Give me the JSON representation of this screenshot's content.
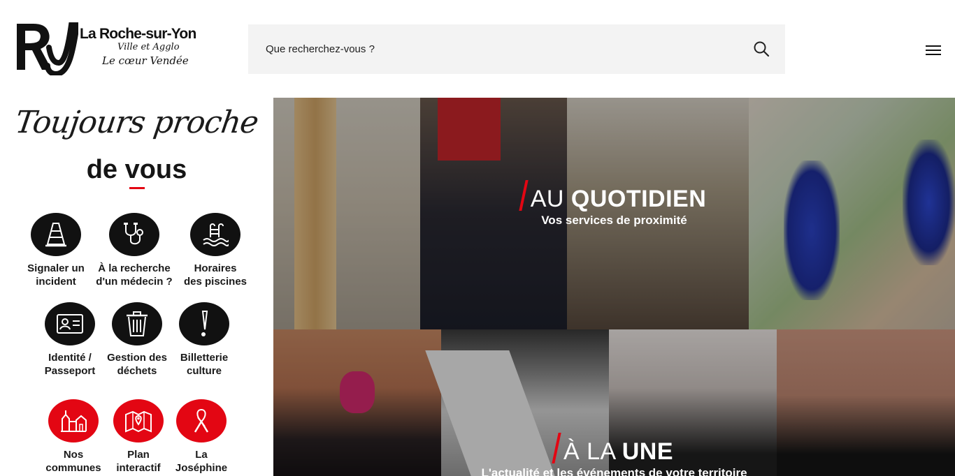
{
  "header": {
    "logo": {
      "monogram": "Ry",
      "name": "La Roche-sur-Yon",
      "line1": "Ville et Agglo",
      "line2": "Le cœur Vendée"
    },
    "search": {
      "placeholder": "Que recherchez-vous ?"
    }
  },
  "tagline": {
    "script": "Toujours proche",
    "bold": "de vous"
  },
  "services": [
    {
      "label": "Signaler un\nincident",
      "icon": "traffic-cone-icon",
      "color": "dark"
    },
    {
      "label": "À la recherche\nd'un médecin ?",
      "icon": "stethoscope-icon",
      "color": "dark"
    },
    {
      "label": "Horaires\ndes piscines",
      "icon": "swimming-pool-icon",
      "color": "dark"
    },
    {
      "label": "Identité /\nPasseport",
      "icon": "id-card-icon",
      "color": "dark"
    },
    {
      "label": "Gestion des\ndéchets",
      "icon": "trash-can-icon",
      "color": "dark"
    },
    {
      "label": "Billetterie\nculture",
      "icon": "exclamation-icon",
      "color": "dark"
    },
    {
      "label": "Nos\ncommunes",
      "icon": "town-icon",
      "color": "red"
    },
    {
      "label": "Plan\ninteractif",
      "icon": "map-icon",
      "color": "red"
    },
    {
      "label": "La\nJoséphine",
      "icon": "awareness-ribbon-icon",
      "color": "red"
    }
  ],
  "hero": {
    "quotidien": {
      "title_light": "AU ",
      "title_bold": "QUOTIDIEN",
      "subtitle": "Vos services de proximité"
    },
    "une": {
      "title_light": "À LA ",
      "title_bold": "UNE",
      "subtitle": "L'actualité et les événements de votre territoire"
    }
  },
  "colors": {
    "accent": "#e30613",
    "dark": "#111111",
    "search_bg": "#f3f3f3"
  }
}
